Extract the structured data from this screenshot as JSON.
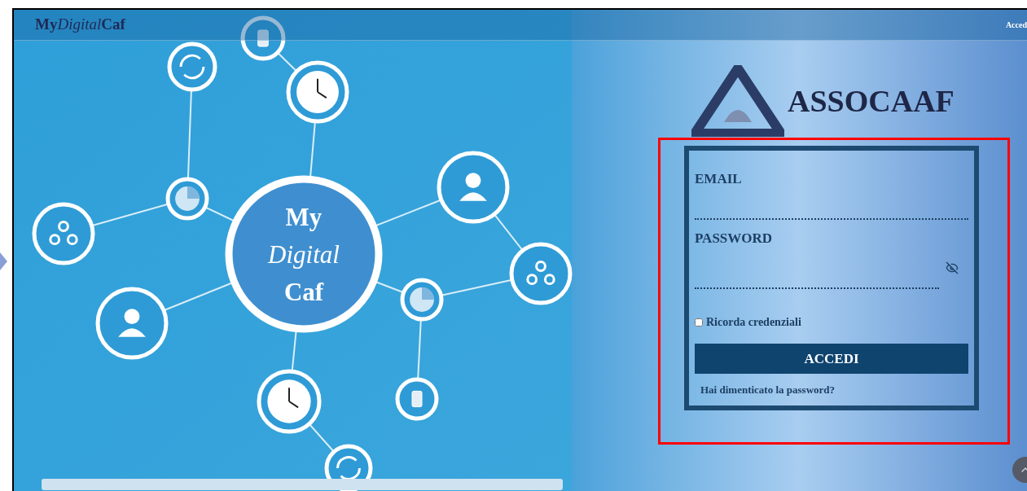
{
  "header": {
    "logo": [
      {
        "text": "My",
        "italic": false
      },
      {
        "text": "Digital",
        "italic": true
      },
      {
        "text": "Caf",
        "italic": false
      }
    ],
    "login_link": "Acced"
  },
  "hero": {
    "center_label": [
      "My",
      "Digital",
      "Caf"
    ]
  },
  "brand": {
    "name": "ASSOCAAF"
  },
  "login_form": {
    "fields": [
      {
        "label": "EMAIL",
        "kind": "text"
      },
      {
        "label": "PASSWORD",
        "kind": "password"
      }
    ],
    "remember": {
      "label": "Ricorda credenziali",
      "checked": false
    },
    "submit": "ACCEDI",
    "forgot_link": "Hai dimenticato la password?"
  }
}
